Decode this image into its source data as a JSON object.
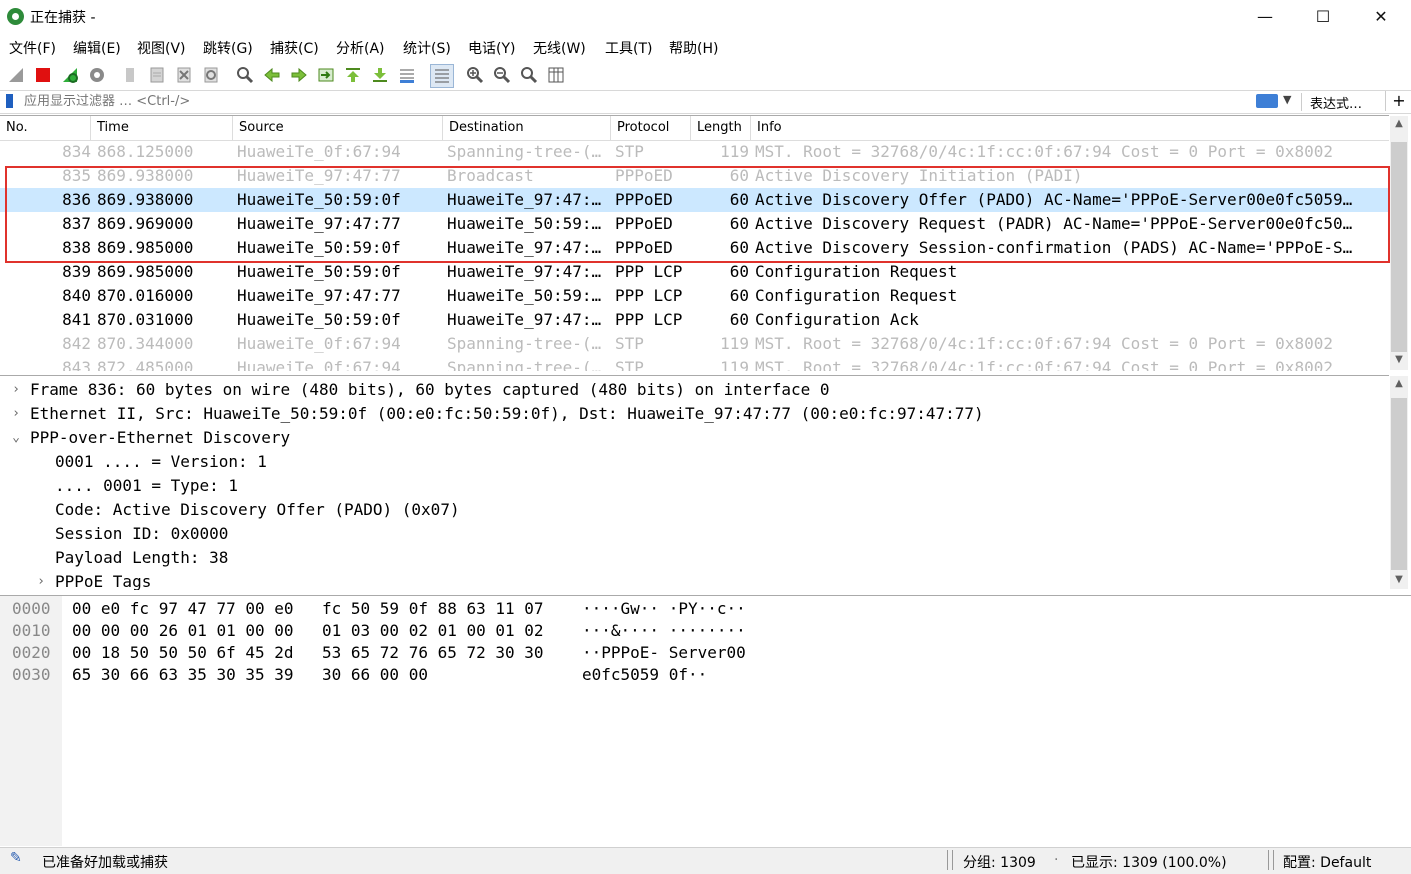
{
  "window": {
    "title": "正在捕获 -",
    "minimize": "—",
    "maximize": "☐",
    "close": "✕"
  },
  "menu": [
    "文件(F)",
    "编辑(E)",
    "视图(V)",
    "跳转(G)",
    "捕获(C)",
    "分析(A)",
    "统计(S)",
    "电话(Y)",
    "无线(W)",
    "工具(T)",
    "帮助(H)"
  ],
  "toolbar": {
    "icons": [
      "shark-fin-icon",
      "stop-capture-icon",
      "restart-capture-icon",
      "capture-options-icon",
      "open-file-icon",
      "save-file-icon",
      "close-file-icon",
      "reload-file-icon",
      "find-packet-icon",
      "go-back-icon",
      "go-forward-icon",
      "go-to-packet-icon",
      "go-first-icon",
      "go-last-icon",
      "auto-scroll-icon",
      "colorize-icon",
      "zoom-in-icon",
      "zoom-out-icon",
      "normal-size-icon",
      "resize-columns-icon"
    ]
  },
  "filter": {
    "placeholder": "应用显示过滤器 … <Ctrl-/>",
    "expression_label": "表达式…",
    "add_label": "+"
  },
  "packet_list": {
    "columns": [
      "No.",
      "Time",
      "Source",
      "Destination",
      "Protocol",
      "Length",
      "Info"
    ],
    "rows": [
      {
        "no": "834",
        "time": "868.125000",
        "src": "HuaweiTe_0f:67:94",
        "dst": "Spanning-tree-(…",
        "proto": "STP",
        "len": "119",
        "info": "MST. Root = 32768/0/4c:1f:cc:0f:67:94  Cost = 0  Port = 0x8002",
        "style": "dim"
      },
      {
        "no": "835",
        "time": "869.938000",
        "src": "HuaweiTe_97:47:77",
        "dst": "Broadcast",
        "proto": "PPPoED",
        "len": "60",
        "info": "Active Discovery Initiation (PADI)",
        "style": "dim"
      },
      {
        "no": "836",
        "time": "869.938000",
        "src": "HuaweiTe_50:59:0f",
        "dst": "HuaweiTe_97:47:…",
        "proto": "PPPoED",
        "len": "60",
        "info": "Active Discovery Offer (PADO) AC-Name='PPPoE-Server00e0fc5059…",
        "style": "sel"
      },
      {
        "no": "837",
        "time": "869.969000",
        "src": "HuaweiTe_97:47:77",
        "dst": "HuaweiTe_50:59:…",
        "proto": "PPPoED",
        "len": "60",
        "info": "Active Discovery Request (PADR) AC-Name='PPPoE-Server00e0fc50…",
        "style": "normal"
      },
      {
        "no": "838",
        "time": "869.985000",
        "src": "HuaweiTe_50:59:0f",
        "dst": "HuaweiTe_97:47:…",
        "proto": "PPPoED",
        "len": "60",
        "info": "Active Discovery Session-confirmation (PADS) AC-Name='PPPoE-S…",
        "style": "normal"
      },
      {
        "no": "839",
        "time": "869.985000",
        "src": "HuaweiTe_50:59:0f",
        "dst": "HuaweiTe_97:47:…",
        "proto": "PPP LCP",
        "len": "60",
        "info": "Configuration Request",
        "style": "normal"
      },
      {
        "no": "840",
        "time": "870.016000",
        "src": "HuaweiTe_97:47:77",
        "dst": "HuaweiTe_50:59:…",
        "proto": "PPP LCP",
        "len": "60",
        "info": "Configuration Request",
        "style": "normal"
      },
      {
        "no": "841",
        "time": "870.031000",
        "src": "HuaweiTe_50:59:0f",
        "dst": "HuaweiTe_97:47:…",
        "proto": "PPP LCP",
        "len": "60",
        "info": "Configuration Ack",
        "style": "normal"
      },
      {
        "no": "842",
        "time": "870.344000",
        "src": "HuaweiTe_0f:67:94",
        "dst": "Spanning-tree-(…",
        "proto": "STP",
        "len": "119",
        "info": "MST. Root = 32768/0/4c:1f:cc:0f:67:94  Cost = 0  Port = 0x8002",
        "style": "dim"
      },
      {
        "no": "843",
        "time": "872.485000",
        "src": "HuaweiTe_0f:67:94",
        "dst": "Spanning-tree-(…",
        "proto": "STP",
        "len": "119",
        "info": "MST. Root = 32768/0/4c:1f:cc:0f:67:94  Cost = 0  Port = 0x8002",
        "style": "dim"
      }
    ]
  },
  "details": [
    {
      "text": "Frame 836: 60 bytes on wire (480 bits), 60 bytes captured (480 bits) on interface 0",
      "level": 0,
      "arrow": "›"
    },
    {
      "text": "Ethernet II, Src: HuaweiTe_50:59:0f (00:e0:fc:50:59:0f), Dst: HuaweiTe_97:47:77 (00:e0:fc:97:47:77)",
      "level": 0,
      "arrow": "›"
    },
    {
      "text": "PPP-over-Ethernet Discovery",
      "level": 0,
      "arrow": "⌄"
    },
    {
      "text": "0001 .... = Version: 1",
      "level": 1,
      "arrow": ""
    },
    {
      "text": ".... 0001 = Type: 1",
      "level": 1,
      "arrow": ""
    },
    {
      "text": "Code: Active Discovery Offer (PADO) (0x07)",
      "level": 1,
      "arrow": ""
    },
    {
      "text": "Session ID: 0x0000",
      "level": 1,
      "arrow": ""
    },
    {
      "text": "Payload Length: 38",
      "level": 1,
      "arrow": ""
    },
    {
      "text": "PPPoE Tags",
      "level": 1,
      "arrow": "›"
    }
  ],
  "bytes": [
    {
      "offset": "0000",
      "hex1": "00 e0 fc 97 47 77 00 e0",
      "hex2": "fc 50 59 0f 88 63 11 07",
      "ascii": "····Gw·· ·PY··c··"
    },
    {
      "offset": "0010",
      "hex1": "00 00 00 26 01 01 00 00",
      "hex2": "01 03 00 02 01 00 01 02",
      "ascii": "···&···· ········"
    },
    {
      "offset": "0020",
      "hex1": "00 18 50 50 50 6f 45 2d",
      "hex2": "53 65 72 76 65 72 30 30",
      "ascii": "··PPPoE- Server00"
    },
    {
      "offset": "0030",
      "hex1": "65 30 66 63 35 30 35 39",
      "hex2": "30 66 00 00",
      "ascii": "e0fc5059 0f··"
    }
  ],
  "status": {
    "ready": "已准备好加载或捕获",
    "packets": "分组: 1309",
    "displayed": "已显示: 1309 (100.0%)",
    "profile": "配置: Default"
  }
}
